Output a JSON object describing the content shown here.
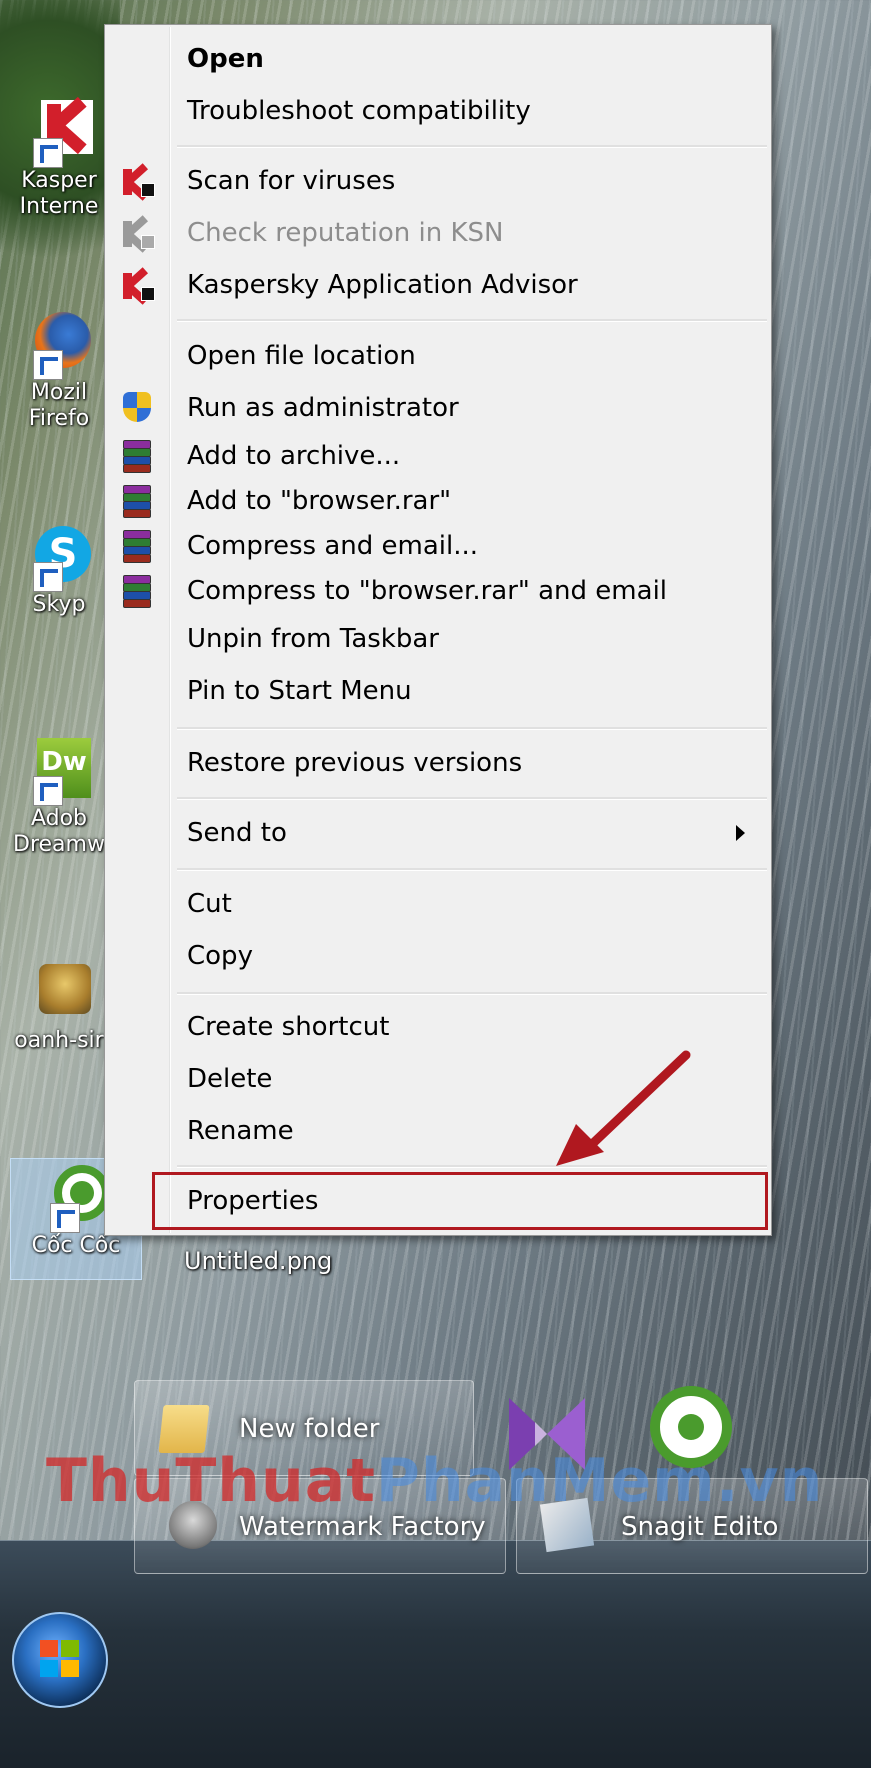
{
  "desktop": {
    "icons": [
      {
        "label": "Kasper\nInterne",
        "icon": "kaspersky-icon"
      },
      {
        "label": "Mozil\nFirefo",
        "icon": "firefox-icon"
      },
      {
        "label": "Skyp",
        "icon": "skype-icon"
      },
      {
        "label": "Adob\nDreamw",
        "icon": "dreamweaver-icon"
      },
      {
        "label": "oanh-sir",
        "icon": "game-icon"
      },
      {
        "label": "Cốc Cốc",
        "icon": "coccoc-icon"
      }
    ],
    "file_label": "Untitled.png"
  },
  "context_menu": {
    "items": [
      {
        "label": "Open",
        "bold": true
      },
      {
        "label": "Troubleshoot compatibility"
      },
      {
        "label": "Scan for viruses",
        "icon": "kaspersky-icon"
      },
      {
        "label": "Check reputation in KSN",
        "icon": "kaspersky-icon",
        "disabled": true
      },
      {
        "label": "Kaspersky Application Advisor",
        "icon": "kaspersky-icon"
      },
      {
        "label": "Open file location"
      },
      {
        "label": "Run as administrator",
        "icon": "uac-shield-icon"
      },
      {
        "label": "Add to archive...",
        "icon": "winrar-icon"
      },
      {
        "label": "Add to \"browser.rar\"",
        "icon": "winrar-icon"
      },
      {
        "label": "Compress and email...",
        "icon": "winrar-icon"
      },
      {
        "label": "Compress to \"browser.rar\" and email",
        "icon": "winrar-icon"
      },
      {
        "label": "Unpin from Taskbar"
      },
      {
        "label": "Pin to Start Menu"
      },
      {
        "label": "Restore previous versions"
      },
      {
        "label": "Send to",
        "submenu": true
      },
      {
        "label": "Cut"
      },
      {
        "label": "Copy"
      },
      {
        "label": "Create shortcut"
      },
      {
        "label": "Delete"
      },
      {
        "label": "Rename"
      },
      {
        "label": "Properties",
        "highlighted": true
      }
    ]
  },
  "annotation": {
    "color": "#b0181f"
  },
  "taskbar": {
    "buttons": [
      {
        "label": "New folder",
        "icon": "folder-icon"
      },
      {
        "label": "",
        "icon": "visual-studio-icon"
      },
      {
        "label": "",
        "icon": "coccoc-icon"
      },
      {
        "label": "Watermark Factory",
        "icon": "watermark-factory-icon"
      },
      {
        "label": "Snagit Edito",
        "icon": "snagit-icon"
      }
    ]
  },
  "watermark": {
    "part1": "Thu",
    "part2": "Thuat",
    "part3": "PhanMem",
    "part4": ".vn"
  }
}
